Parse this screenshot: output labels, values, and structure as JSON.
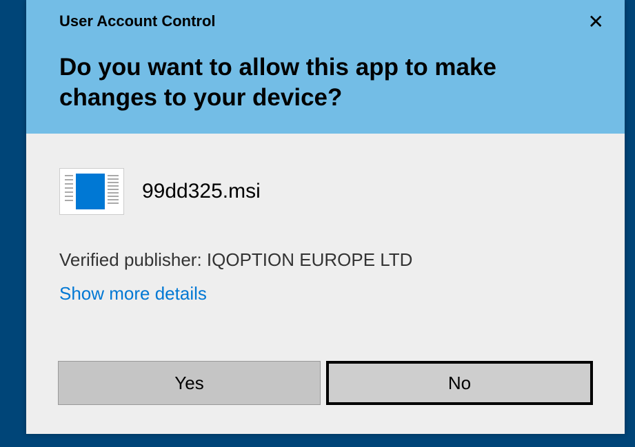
{
  "header": {
    "small_title": "User Account Control",
    "main_title": "Do you want to allow this app to make changes to your device?"
  },
  "app": {
    "filename": "99dd325.msi"
  },
  "publisher": {
    "label": "Verified publisher: IQOPTION EUROPE LTD"
  },
  "details_link": "Show more details",
  "buttons": {
    "yes": "Yes",
    "no": "No"
  }
}
